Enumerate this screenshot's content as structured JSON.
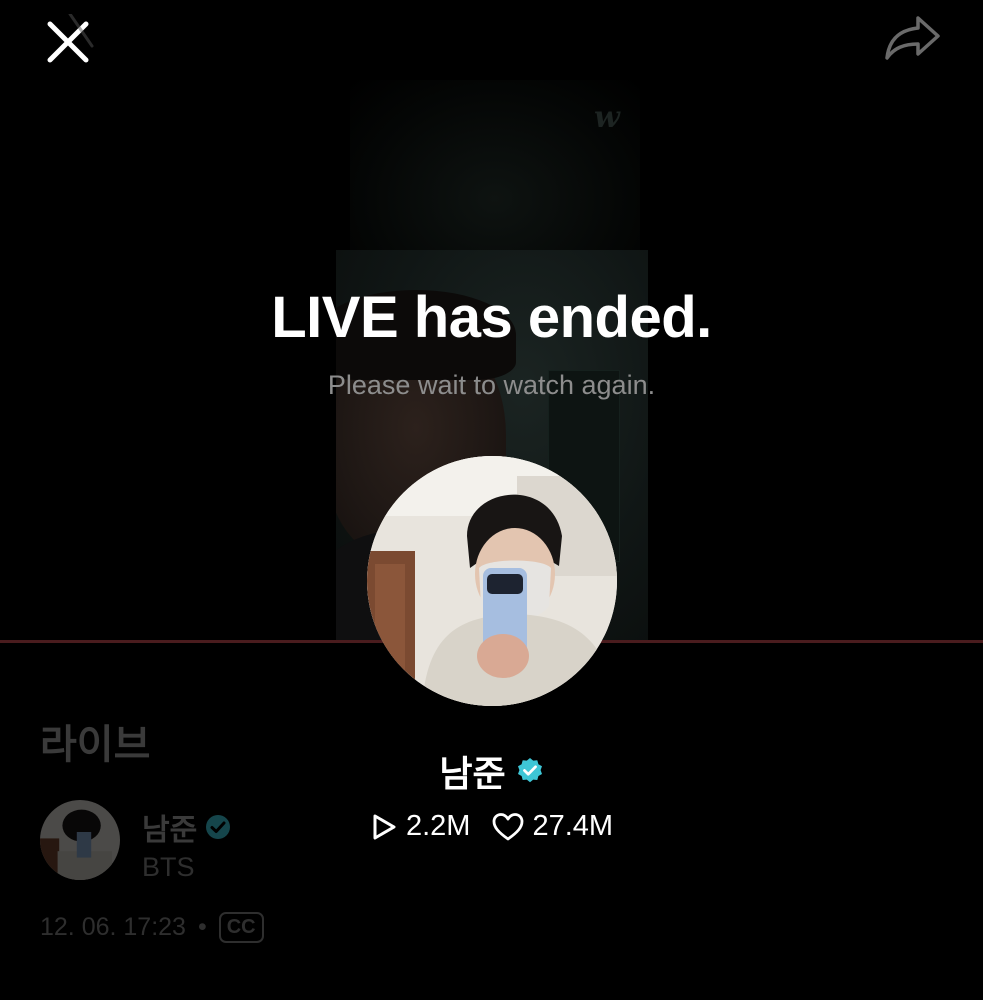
{
  "watermark": "w",
  "ended": {
    "title": "LIVE has ended.",
    "subtitle": "Please wait to watch again."
  },
  "profile": {
    "name": "남준",
    "verified": true,
    "plays": "2.2M",
    "likes": "27.4M"
  },
  "page": {
    "section_title": "라이브",
    "artist_name": "남준",
    "artist_group": "BTS",
    "date": "12. 06. 17:23",
    "separator": "•",
    "cc_label": "CC"
  },
  "icons": {
    "close": "close-icon",
    "share": "share-icon",
    "verified": "verified-badge-icon",
    "play": "play-icon",
    "like": "heart-icon"
  },
  "colors": {
    "background": "#000000",
    "verified_badge": "#3ec6d6",
    "progress_line": "#4a1c1e",
    "subtitle": "#8d8d8d"
  }
}
